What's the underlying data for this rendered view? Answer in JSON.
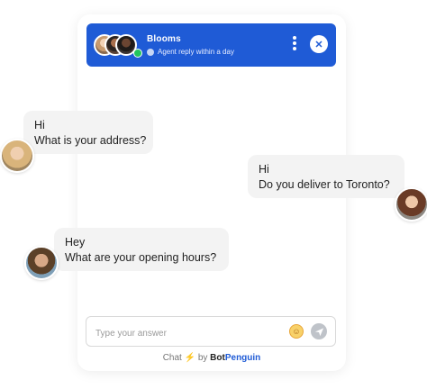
{
  "header": {
    "bot_name": "Blooms",
    "reply_info": "Agent reply within a day",
    "close_icon": "close-icon",
    "menu_icon": "more-vertical-icon"
  },
  "messages": [
    {
      "side": "left",
      "line1": "Hi",
      "line2": "What is your address?"
    },
    {
      "side": "right",
      "line1": "Hi",
      "line2": "Do you deliver to Toronto?"
    },
    {
      "side": "left",
      "line1": "Hey",
      "line2": "What are your opening hours?"
    }
  ],
  "composer": {
    "placeholder": "Type your answer",
    "value": "",
    "emoji_icon": "emoji-icon",
    "send_icon": "send-icon"
  },
  "footer": {
    "chat": "Chat",
    "by": "by",
    "brand_part1": "Bot",
    "brand_part2": "Penguin"
  },
  "colors": {
    "header_bg": "#1f5bd6",
    "online": "#22c55e",
    "bubble_bg": "#f3f3f3",
    "bolt": "#f5b400"
  }
}
